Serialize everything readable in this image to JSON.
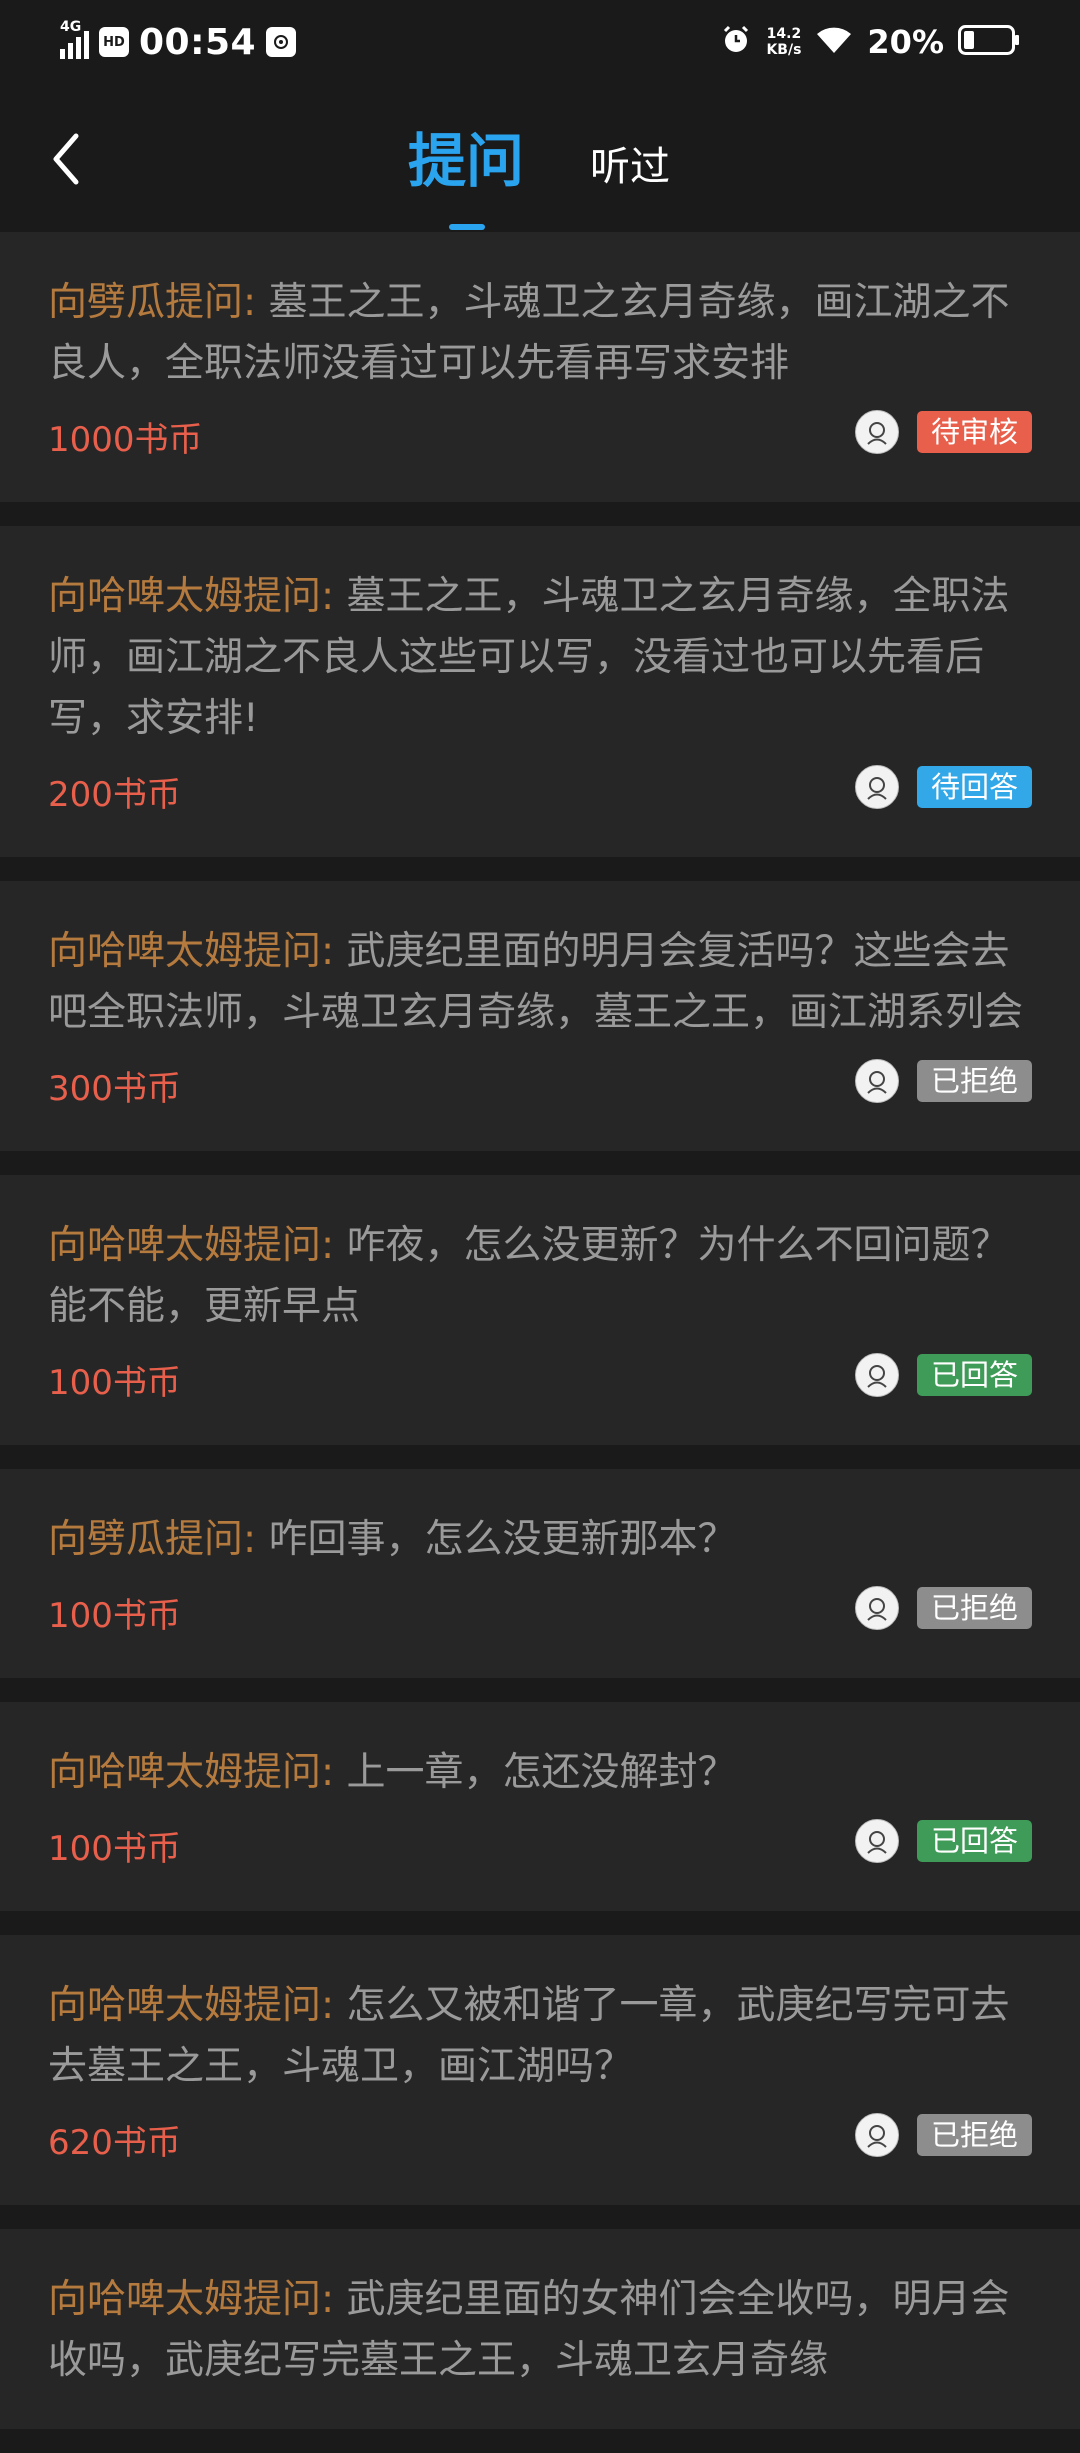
{
  "status_bar": {
    "network": "4G",
    "hd_label": "HD",
    "time": "00:54",
    "speed_value": "14.2",
    "speed_unit": "KB/s",
    "battery": "20%"
  },
  "header": {
    "tab_active": "提问",
    "tab_inactive": "听过"
  },
  "colors": {
    "accent": "#2ba4f0",
    "coins": "#e8604c",
    "asker": "#b57a3e",
    "badge_pending_review": "#e8604c",
    "badge_pending_answer": "#32a8e8",
    "badge_rejected": "#8d8d8d",
    "badge_answered": "#3f9b58"
  },
  "questions": [
    {
      "asker": "向劈瓜提问:",
      "text": "墓王之王，斗魂卫之玄月奇缘，画江湖之不良人，全职法师没看过可以先看再写求安排",
      "coins": "1000书币",
      "status": "待审核",
      "status_type": "pending-review"
    },
    {
      "asker": "向哈啤太姆提问:",
      "text": "墓王之王，斗魂卫之玄月奇缘，全职法师，画江湖之不良人这些可以写，没看过也可以先看后写，求安排!",
      "coins": "200书币",
      "status": "待回答",
      "status_type": "pending-answer"
    },
    {
      "asker": "向哈啤太姆提问:",
      "text": "武庚纪里面的明月会复活吗？这些会去吧全职法师，斗魂卫玄月奇缘，墓王之王，画江湖系列会",
      "coins": "300书币",
      "status": "已拒绝",
      "status_type": "rejected"
    },
    {
      "asker": "向哈啤太姆提问:",
      "text": "咋夜，怎么没更新？为什么不回问题？能不能，更新早点",
      "coins": "100书币",
      "status": "已回答",
      "status_type": "answered"
    },
    {
      "asker": "向劈瓜提问:",
      "text": "咋回事，怎么没更新那本？",
      "coins": "100书币",
      "status": "已拒绝",
      "status_type": "rejected"
    },
    {
      "asker": "向哈啤太姆提问:",
      "text": "上一章，怎还没解封？",
      "coins": "100书币",
      "status": "已回答",
      "status_type": "answered"
    },
    {
      "asker": "向哈啤太姆提问:",
      "text": "怎么又被和谐了一章，武庚纪写完可去去墓王之王，斗魂卫，画江湖吗？",
      "coins": "620书币",
      "status": "已拒绝",
      "status_type": "rejected"
    },
    {
      "asker": "向哈啤太姆提问:",
      "text": "武庚纪里面的女神们会全收吗，明月会收吗，武庚纪写完墓王之王，斗魂卫玄月奇缘",
      "coins": "",
      "status": "",
      "status_type": ""
    }
  ]
}
